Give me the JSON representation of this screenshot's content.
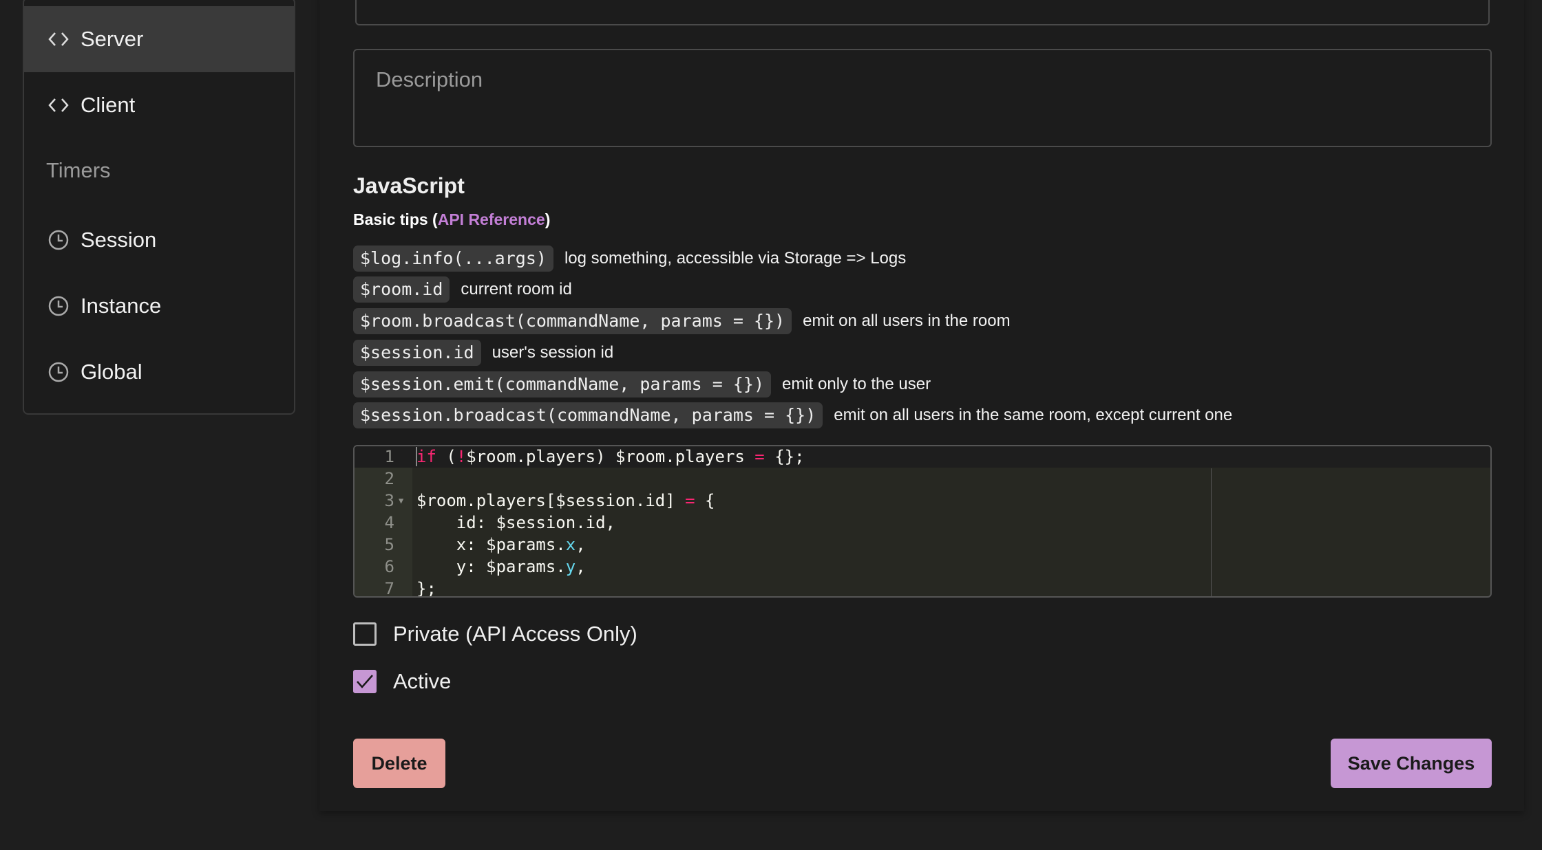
{
  "sidebar": {
    "items": [
      {
        "label": "Server",
        "icon": "code-icon",
        "active": true
      },
      {
        "label": "Client",
        "icon": "code-icon",
        "active": false
      }
    ],
    "timers_heading": "Timers",
    "timers": [
      {
        "label": "Session",
        "icon": "clock-icon"
      },
      {
        "label": "Instance",
        "icon": "clock-icon"
      },
      {
        "label": "Global",
        "icon": "clock-icon"
      }
    ]
  },
  "form": {
    "description_placeholder": "Description",
    "js_heading": "JavaScript",
    "tips_prefix": "Basic tips (",
    "tips_link": "API Reference",
    "tips_suffix": ")",
    "tips": [
      {
        "code": "$log.info(...args)",
        "desc": "log something, accessible via Storage => Logs"
      },
      {
        "code": "$room.id",
        "desc": "current room id"
      },
      {
        "code": "$room.broadcast(commandName, params = {})",
        "desc": "emit on all users in the room"
      },
      {
        "code": "$session.id",
        "desc": "user's session id"
      },
      {
        "code": "$session.emit(commandName, params = {})",
        "desc": "emit only to the user"
      },
      {
        "code": "$session.broadcast(commandName, params = {})",
        "desc": "emit on all users in the same room, except current one"
      }
    ],
    "code_lines": [
      "if (!$room.players) $room.players = {};",
      "",
      "$room.players[$session.id] = {",
      "    id: $session.id,",
      "    x: $params.x,",
      "    y: $params.y,",
      "};"
    ],
    "private_label": "Private (API Access Only)",
    "private_checked": false,
    "active_label": "Active",
    "active_checked": true,
    "delete_label": "Delete",
    "save_label": "Save Changes"
  },
  "colors": {
    "accent": "#c697d4",
    "danger": "#e69f9a",
    "link": "#c37fd6",
    "background": "#1e1e1e",
    "editor_bg": "#272822"
  }
}
